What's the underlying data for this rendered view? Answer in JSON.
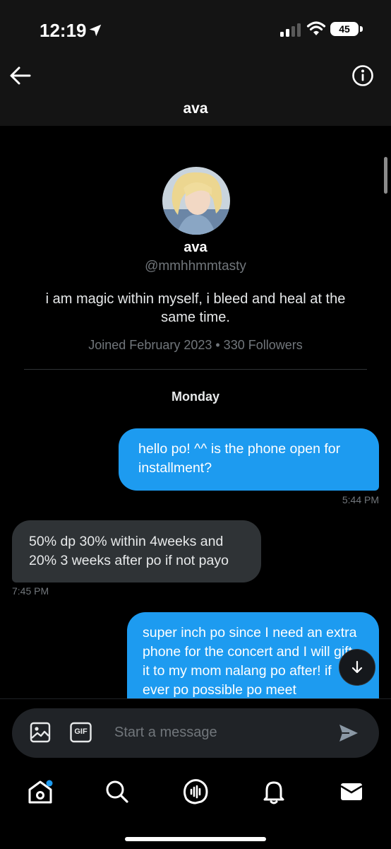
{
  "status_bar": {
    "time": "12:19",
    "battery": "45"
  },
  "header": {
    "title": "ava"
  },
  "profile": {
    "name": "ava",
    "handle": "@mmhhmmtasty",
    "bio": "i am magic within myself, i bleed and heal at the same time.",
    "meta": "Joined February 2023 • 330 Followers"
  },
  "conversation": {
    "day_label": "Monday",
    "messages": [
      {
        "direction": "sent",
        "text": "hello po! ^^ is the phone open for installment?",
        "time": "5:44 PM"
      },
      {
        "direction": "received",
        "text": "50% dp 30% within 4weeks and 20% 3 weeks after po if not payo",
        "time": "7:45 PM"
      },
      {
        "direction": "sent",
        "text": "super inch po since I need an extra phone for the concert and I will gift it to my mom nalang po after! if ever po possible po meet"
      }
    ]
  },
  "composer": {
    "placeholder": "Start a message",
    "gif_label": "GIF"
  },
  "colors": {
    "accent": "#1d9bf0",
    "background": "#000000",
    "received_bubble": "#2f3336",
    "muted_text": "#71767b"
  },
  "icons": [
    "back-arrow-icon",
    "info-icon",
    "location-arrow-icon",
    "signal-icon",
    "wifi-icon",
    "image-icon",
    "gif-icon",
    "send-icon",
    "arrow-down-icon",
    "home-icon",
    "search-icon",
    "spaces-icon",
    "bell-icon",
    "mail-icon"
  ]
}
